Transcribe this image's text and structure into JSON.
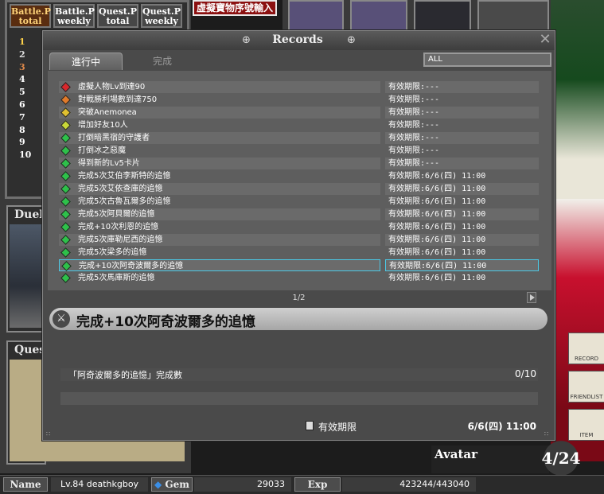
{
  "ranking": {
    "tabs": [
      "Battle.P\ntotal",
      "Battle.P\nweekly",
      "Quest.P\ntotal",
      "Quest.P\nweekly"
    ],
    "ranks": [
      "1",
      "2",
      "3",
      "4",
      "5",
      "6",
      "7",
      "8",
      "9",
      "10"
    ]
  },
  "top_banner": "虛擬寶物序號輸入",
  "panels": {
    "duel": "Duel",
    "quest": "Quest"
  },
  "side_buttons": {
    "record": "RECORD",
    "friendlist": "FRIENDLIST",
    "item": "ITEM"
  },
  "avatar_label": "Avatar",
  "page_badge": "4/24",
  "status_bar": {
    "name_label": "Name",
    "name_value": "Lv.84 deathkgboy",
    "gem_label": "Gem",
    "gem_value": "29033",
    "exp_label": "Exp",
    "exp_value": "423244/443040"
  },
  "records": {
    "title": "Records",
    "tab_active": "進行中",
    "tab_done": "完成",
    "filter": "ALL",
    "pager": "1/2",
    "rows": [
      {
        "name": "虛擬人物Lv到達90",
        "expiry": "有效期限:---",
        "gem": "#d8282c"
      },
      {
        "name": "對戰勝利場數到達750",
        "expiry": "有效期限:---",
        "gem": "#e07a2a"
      },
      {
        "name": "突破Anemonea",
        "expiry": "有效期限:---",
        "gem": "#e0c030"
      },
      {
        "name": "增加好友10人",
        "expiry": "有效期限:---",
        "gem": "#c8d838"
      },
      {
        "name": "打倒暗黑宿的守護者",
        "expiry": "有效期限:---",
        "gem": "#2ec04a"
      },
      {
        "name": "打倒冰之惡魔",
        "expiry": "有效期限:---",
        "gem": "#2ec04a"
      },
      {
        "name": "得到新的Lv5卡片",
        "expiry": "有效期限:---",
        "gem": "#2ec04a"
      },
      {
        "name": "完成5次艾伯李斯特的追憶",
        "expiry": "有效期限:6/6(四) 11:00",
        "gem": "#2ec04a"
      },
      {
        "name": "完成5次艾依查庫的追憶",
        "expiry": "有效期限:6/6(四) 11:00",
        "gem": "#2ec04a"
      },
      {
        "name": "完成5次古魯瓦爾多的追憶",
        "expiry": "有效期限:6/6(四) 11:00",
        "gem": "#2ec04a"
      },
      {
        "name": "完成5次阿貝爾的追憶",
        "expiry": "有效期限:6/6(四) 11:00",
        "gem": "#2ec04a"
      },
      {
        "name": "完成+10次利恩的追憶",
        "expiry": "有效期限:6/6(四) 11:00",
        "gem": "#2ec04a"
      },
      {
        "name": "完成5次庫勒尼西的追憶",
        "expiry": "有效期限:6/6(四) 11:00",
        "gem": "#2ec04a"
      },
      {
        "name": "完成5次梁多的追憶",
        "expiry": "有效期限:6/6(四) 11:00",
        "gem": "#2ec04a"
      },
      {
        "name": "完成+10次阿奇波爾多的追憶",
        "expiry": "有效期限:6/6(四) 11:00",
        "gem": "#2ec04a"
      },
      {
        "name": "完成5次馬庫斯的追憶",
        "expiry": "有效期限:6/6(四) 11:00",
        "gem": "#2ec04a"
      }
    ],
    "selected_index": 14,
    "detail": {
      "title": "完成+10次阿奇波爾多的追憶",
      "condition": "「阿奇波爾多的追憶」完成數",
      "count": "0/10",
      "progress": 0,
      "expiry_label": "有效期限",
      "expiry_value": "6/6(四) 11:00"
    }
  }
}
